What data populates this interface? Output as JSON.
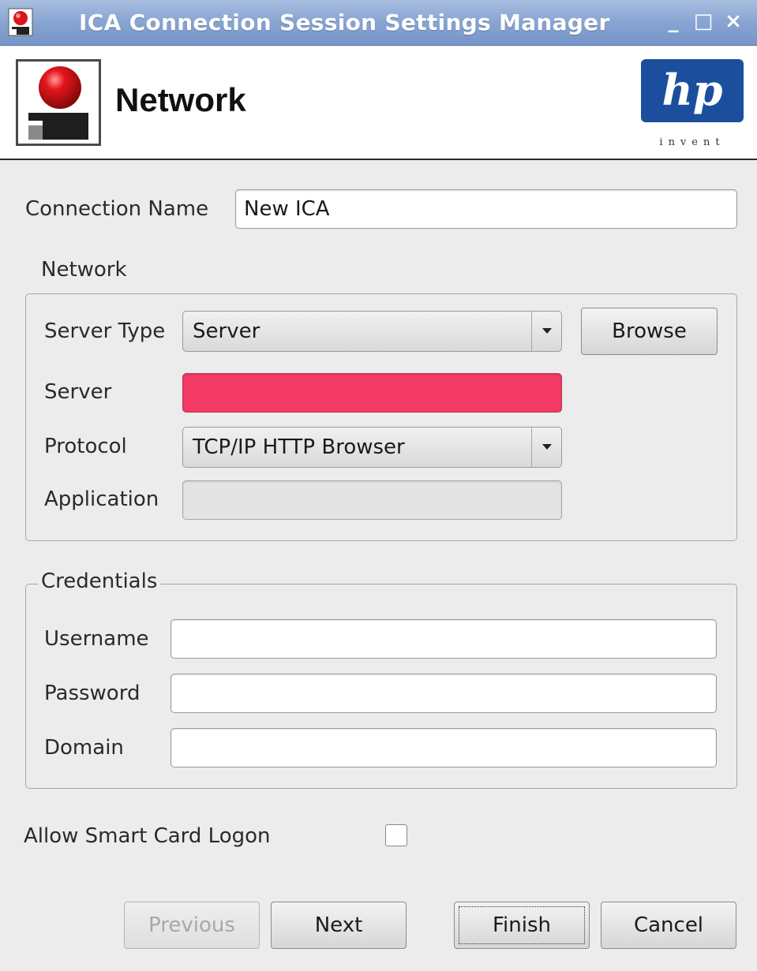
{
  "window": {
    "title": "ICA Connection Session Settings Manager",
    "minimize": "_",
    "maximize": "□",
    "close": "×"
  },
  "header": {
    "page_title": "Network",
    "logo_text": "hp",
    "logo_tagline": "invent"
  },
  "connection_name": {
    "label": "Connection Name",
    "value": "New ICA"
  },
  "network_group": {
    "title": "Network",
    "server_type": {
      "label": "Server Type",
      "value": "Server"
    },
    "browse_label": "Browse",
    "server": {
      "label": "Server",
      "value": ""
    },
    "protocol": {
      "label": "Protocol",
      "value": "TCP/IP HTTP Browser"
    },
    "application": {
      "label": "Application",
      "value": ""
    }
  },
  "credentials_group": {
    "title": "Credentials",
    "username": {
      "label": "Username",
      "value": ""
    },
    "password": {
      "label": "Password",
      "value": ""
    },
    "domain": {
      "label": "Domain",
      "value": ""
    }
  },
  "smart_card": {
    "label": "Allow Smart Card Logon",
    "checked": false
  },
  "buttons": {
    "previous": "Previous",
    "next": "Next",
    "finish": "Finish",
    "cancel": "Cancel"
  },
  "colors": {
    "titlebar": "#7f9ccd",
    "required_field": "#f23a64",
    "hp_blue": "#1b4f9e"
  }
}
